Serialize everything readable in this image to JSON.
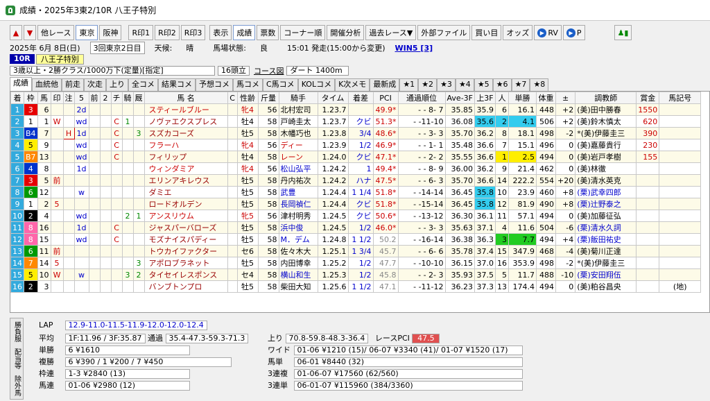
{
  "window": {
    "title": "成績・2025年3東2/10R 八王子特別"
  },
  "toolbar": {
    "items": [
      "他レース",
      "東京",
      "阪神",
      "R印1",
      "R印2",
      "R印3",
      "表示",
      "成績",
      "票数",
      "コーナー順",
      "開催分析",
      "過去レース▼",
      "外部ファイル",
      "買い目",
      "オッズ",
      "RV",
      "P"
    ]
  },
  "info": {
    "date": "2025年 6月 8日(日)",
    "kaisai": "3回東京2日目",
    "weather_label": "天候:",
    "weather": "晴",
    "track_label": "馬場状態:",
    "track": "良",
    "start": "15:01 発走(15:00から変更)",
    "win5": "WIN5 [3]"
  },
  "race": {
    "num": "10R",
    "name": "八王子特別",
    "cond": "3歳以上・2勝クラス/1000万下(定量)[指定]",
    "heads": "16頭立",
    "course_label": "コース図",
    "course": "ダート 1400m"
  },
  "tabs": [
    "成績",
    "血統他",
    "前走",
    "次走",
    "上り",
    "全コメ",
    "結果コメ",
    "予想コメ",
    "馬コメ",
    "C馬コメ",
    "KOLコメ",
    "K次メモ",
    "最新成",
    "★1",
    "★2",
    "★3",
    "★4",
    "★5",
    "★6",
    "★7",
    "★8"
  ],
  "columns": [
    "着",
    "枠",
    "馬",
    "印",
    "注",
    "5",
    "前",
    "2",
    "チ",
    "騎",
    "厩",
    "馬 名",
    "C",
    "性齢",
    "斤量",
    "騎手",
    "タイム",
    "着差",
    "PCI",
    "通過順位",
    "Ave-3F",
    "上3F",
    "人",
    "単勝",
    "体重",
    "±",
    "調教師",
    "賞金",
    "馬記号"
  ],
  "rows": [
    [
      "1",
      "3",
      "6",
      "",
      "",
      "2d",
      "",
      "",
      "",
      "",
      "",
      "スティールブルー",
      "",
      "牝4",
      "56",
      "北村宏司",
      "1.23.7",
      "",
      "49.9*",
      "- - 8- 7",
      "35.85",
      "35.9",
      "6",
      "16.1",
      "448",
      "+2",
      "(美)田中勝春",
      "1550",
      ""
    ],
    [
      "2",
      "1",
      "1",
      "W",
      "",
      "wd",
      "",
      "",
      "C",
      "1",
      "",
      "ノヴァエクスプレス",
      "",
      "牡4",
      "58",
      "戸崎圭太",
      "1.23.7",
      "クビ",
      "51.3*",
      "- -11-10",
      "36.08",
      "35.6",
      "2",
      "4.1",
      "506",
      "+2",
      "(美)鈴木慎太",
      "620",
      ""
    ],
    [
      "3",
      "B4",
      "7",
      "",
      "H",
      "1d",
      "",
      "",
      "C",
      "",
      "3",
      "スズカコーズ",
      "",
      "牡5",
      "58",
      "木幡巧也",
      "1.23.8",
      "3/4",
      "48.6*",
      "- - 3- 3",
      "35.70",
      "36.2",
      "8",
      "18.1",
      "498",
      "-2",
      "*(美)伊藤圭三",
      "390",
      ""
    ],
    [
      "4",
      "5",
      "9",
      "",
      "",
      "wd",
      "",
      "",
      "C",
      "",
      "",
      "フラーハ",
      "",
      "牝4",
      "56",
      "ディー",
      "1.23.9",
      "1/2",
      "46.9*",
      "- - 1- 1",
      "35.48",
      "36.6",
      "7",
      "15.1",
      "496",
      "0",
      "(美)嘉藤貴行",
      "230",
      ""
    ],
    [
      "5",
      "B7",
      "13",
      "",
      "",
      "wd",
      "",
      "",
      "C",
      "",
      "",
      "フィリップ",
      "",
      "牡4",
      "58",
      "レーン",
      "1.24.0",
      "クビ",
      "47.1*",
      "- - 2- 2",
      "35.55",
      "36.6",
      "1",
      "2.5",
      "494",
      "0",
      "(美)岩戸孝樹",
      "155",
      ""
    ],
    [
      "6",
      "4",
      "8",
      "",
      "",
      "1d",
      "",
      "",
      "",
      "",
      "",
      "ウィンダミア",
      "",
      "牝4",
      "56",
      "松山弘平",
      "1.24.2",
      "1",
      "49.4*",
      "- - 8- 9",
      "36.00",
      "36.2",
      "9",
      "21.4",
      "462",
      "0",
      "(美)林徹",
      "",
      ""
    ],
    [
      "7",
      "3",
      "5",
      "前",
      "",
      "",
      "",
      "",
      "",
      "",
      "",
      "エリンアキレウス",
      "",
      "牡5",
      "58",
      "丹内祐次",
      "1.24.2",
      "ハナ",
      "47.5*",
      "- - 6- 3",
      "35.70",
      "36.6",
      "14",
      "222.2",
      "554",
      "+20",
      "(美)清水英克",
      "",
      ""
    ],
    [
      "8",
      "6",
      "12",
      "",
      "",
      "w",
      "",
      "",
      "",
      "",
      "",
      "ダミエ",
      "",
      "牡5",
      "58",
      "武豊",
      "1.24.4",
      "1 1/4",
      "51.8*",
      "- -14-14",
      "36.45",
      "35.8",
      "10",
      "23.9",
      "460",
      "+8",
      "(栗)武幸四郎",
      "",
      ""
    ],
    [
      "9",
      "1",
      "2",
      "5",
      "",
      "",
      "",
      "",
      "",
      "",
      "",
      "ロードオルデン",
      "",
      "牡5",
      "58",
      "長岡禎仁",
      "1.24.4",
      "クビ",
      "51.8*",
      "- -15-14",
      "36.45",
      "35.8",
      "12",
      "81.9",
      "490",
      "+8",
      "(栗)辻野泰之",
      "",
      ""
    ],
    [
      "10",
      "2",
      "4",
      "",
      "",
      "wd",
      "",
      "",
      "",
      "2",
      "1",
      "アンスリウム",
      "",
      "牝5",
      "56",
      "津村明秀",
      "1.24.5",
      "クビ",
      "50.6*",
      "- -13-12",
      "36.30",
      "36.1",
      "11",
      "57.1",
      "494",
      "0",
      "(美)加藤征弘",
      "",
      ""
    ],
    [
      "11",
      "8",
      "16",
      "",
      "",
      "1d",
      "",
      "",
      "C",
      "",
      "",
      "ジャスパーバローズ",
      "",
      "牡5",
      "58",
      "浜中俊",
      "1.24.5",
      "1/2",
      "46.0*",
      "- - 3- 3",
      "35.63",
      "37.1",
      "4",
      "11.6",
      "504",
      "-6",
      "(栗)清水久詞",
      "",
      ""
    ],
    [
      "12",
      "8",
      "15",
      "",
      "",
      "wd",
      "",
      "",
      "C",
      "",
      "",
      "モズナイスパディー",
      "",
      "牡5",
      "58",
      "M．デム",
      "1.24.8",
      "1 1/2",
      "50.2",
      "- -16-14",
      "36.38",
      "36.3",
      "3",
      "7.7",
      "494",
      "+4",
      "(栗)飯田祐史",
      "",
      ""
    ],
    [
      "13",
      "6",
      "11",
      "前",
      "",
      "",
      "",
      "",
      "",
      "",
      "",
      "トウカイファクター",
      "",
      "セ6",
      "58",
      "佐々木大",
      "1.25.1",
      "1 3/4",
      "45.7",
      "- - 6- 6",
      "35.78",
      "37.4",
      "15",
      "347.9",
      "468",
      "-4",
      "(美)菊川正達",
      "",
      ""
    ],
    [
      "14",
      "7",
      "14",
      "5",
      "",
      "",
      "",
      "",
      "",
      "",
      "3",
      "アポロブラネット",
      "",
      "牡5",
      "58",
      "内田博幸",
      "1.25.2",
      "1/2",
      "47.7",
      "- -10-10",
      "36.15",
      "37.0",
      "16",
      "353.9",
      "498",
      "-2",
      "*(美)伊藤圭三",
      "",
      ""
    ],
    [
      "15",
      "5",
      "10",
      "W",
      "",
      "w",
      "",
      "",
      "",
      "3",
      "2",
      "タイセイレスポンス",
      "",
      "セ4",
      "58",
      "横山和生",
      "1.25.3",
      "1/2",
      "45.8",
      "- - 2- 3",
      "35.93",
      "37.5",
      "5",
      "11.7",
      "488",
      "-10",
      "(栗)安田翔伍",
      "",
      ""
    ],
    [
      "16",
      "2",
      "3",
      "",
      "",
      "",
      "",
      "",
      "",
      "",
      "",
      "バンブトンプロ",
      "",
      "牡5",
      "58",
      "柴田大知",
      "1.25.6",
      "1 1/2",
      "47.1",
      "- -11-12",
      "36.23",
      "37.3",
      "13",
      "174.4",
      "494",
      "0",
      "(美)粕谷昌央",
      "",
      "(地)"
    ]
  ],
  "lap": {
    "label": "LAP",
    "values": "12.9-11.0-11.5-11.9-12.0-12.0-12.4",
    "avg_label": "平均",
    "avg": "1F:11.96 / 3F:35.87",
    "pass_label": "通過",
    "pass": "35.4-47.3-59.3-71.3",
    "agari_label": "上り",
    "agari": "70.8-59.8-48.3-36.4",
    "pci_label": "レースPCI",
    "pci": "47.5"
  },
  "payouts": {
    "win_label": "単勝",
    "win": "6 ¥1610",
    "place_label": "複勝",
    "place": "6 ¥390 / 1 ¥200 / 7 ¥450",
    "waku_label": "枠連",
    "waku": "1-3 ¥2840 (13)",
    "umaren_label": "馬連",
    "umaren": "01-06 ¥2980 (12)",
    "wide_label": "ワイド",
    "wide": "01-06 ¥1210 (15)/ 06-07 ¥3340 (41)/ 01-07 ¥1520 (17)",
    "umatan_label": "馬単",
    "umatan": "06-01 ¥8440 (32)",
    "fuku3_label": "3連複",
    "fuku3": "01-06-07 ¥17560 (62/560)",
    "tan3_label": "3連単",
    "tan3": "06-01-07 ¥115960 (384/3360)"
  },
  "sidetabs": [
    "勝負服",
    "配当等",
    "除外馬"
  ],
  "colors": {
    "waku": [
      "#ffffff",
      "#000000",
      "#e60000",
      "#0033cc",
      "#ffee00",
      "#009900",
      "#ff8800",
      "#ff66aa"
    ]
  }
}
